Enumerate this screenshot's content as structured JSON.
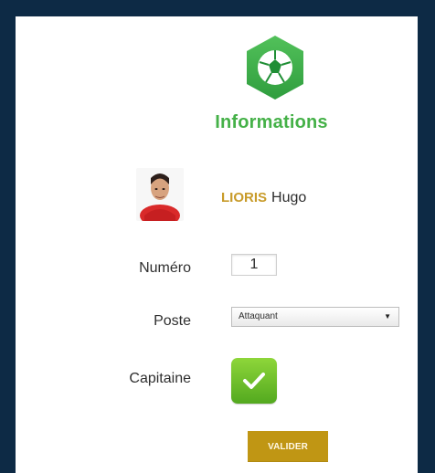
{
  "app": {
    "title": "Informations",
    "logo_icon": "football-icon"
  },
  "player": {
    "last_name": "LIORIS",
    "first_name": "Hugo",
    "avatar_icon": "player-avatar"
  },
  "fields": {
    "numero_label": "Numéro",
    "numero_value": "1",
    "poste_label": "Poste",
    "poste_value": "Attaquant",
    "capitaine_label": "Capitaine",
    "capitaine_checked": true
  },
  "actions": {
    "validate_label": "VALIDER"
  },
  "colors": {
    "background": "#0d2a45",
    "green": "#45b148",
    "gold": "#c09614",
    "name_gold": "#c89b2a"
  }
}
